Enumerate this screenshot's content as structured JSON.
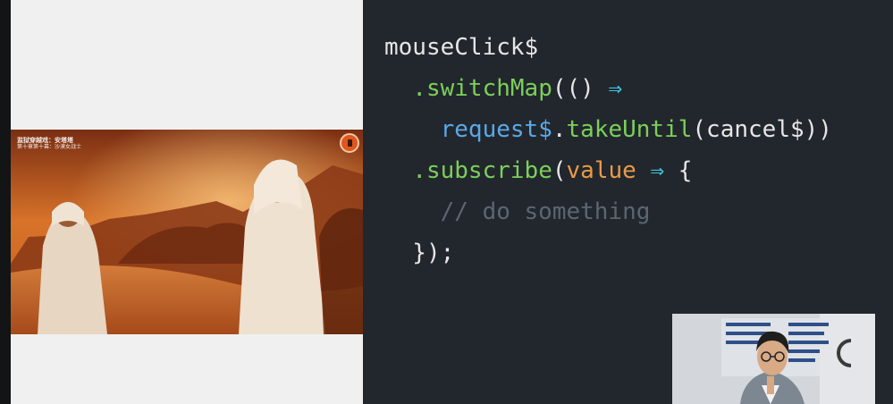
{
  "slide": {
    "code_lines": [
      [
        {
          "t": "mouseClick$",
          "c": "plain"
        }
      ],
      [
        {
          "t": "  ",
          "c": "plain"
        },
        {
          "t": ".switchMap",
          "c": "method"
        },
        {
          "t": "(() ",
          "c": "plain"
        },
        {
          "t": "⇒",
          "c": "arrow"
        }
      ],
      [
        {
          "t": "    ",
          "c": "plain"
        },
        {
          "t": "request$",
          "c": "var"
        },
        {
          "t": ".",
          "c": "plain"
        },
        {
          "t": "takeUntil",
          "c": "method"
        },
        {
          "t": "(cancel$))",
          "c": "plain"
        }
      ],
      [
        {
          "t": "  ",
          "c": "plain"
        },
        {
          "t": ".subscribe",
          "c": "method"
        },
        {
          "t": "(",
          "c": "plain"
        },
        {
          "t": "value",
          "c": "param"
        },
        {
          "t": " ",
          "c": "plain"
        },
        {
          "t": "⇒",
          "c": "arrow"
        },
        {
          "t": " {",
          "c": "plain"
        }
      ],
      [
        {
          "t": "    // do something",
          "c": "comment"
        }
      ],
      [
        {
          "t": "  });",
          "c": "plain"
        }
      ]
    ]
  },
  "photo": {
    "caption_line1": "监狱穿越戏：安塔塔",
    "caption_line2": "第十章第十幕：沙漠女战士",
    "badge_icon": "play-badge-icon"
  },
  "webcam": {
    "description_icon": "presenter-icon"
  },
  "colors": {
    "code_bg": "#22272d",
    "method": "#7ccf5a",
    "variable": "#5aa9e6",
    "arrow": "#39c6e0",
    "param": "#e89a4a",
    "comment": "#5d6570"
  }
}
